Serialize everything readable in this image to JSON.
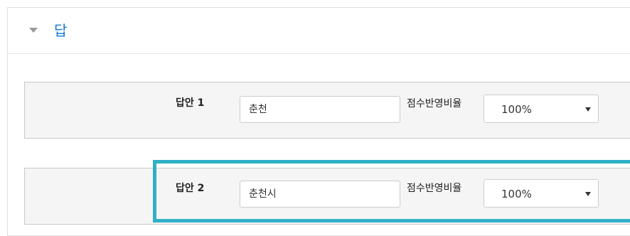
{
  "section": {
    "title": "답"
  },
  "answers": [
    {
      "label": "답안 1",
      "value": "춘천",
      "grade_label": "점수반영비율",
      "grade_value": "100%"
    },
    {
      "label": "답안 2",
      "value": "춘천시",
      "grade_label": "점수반영비율",
      "grade_value": "100%"
    }
  ],
  "colors": {
    "section_title": "#1177d1",
    "row_background": "#f5f5f5",
    "highlight": "#2fb0c6"
  }
}
